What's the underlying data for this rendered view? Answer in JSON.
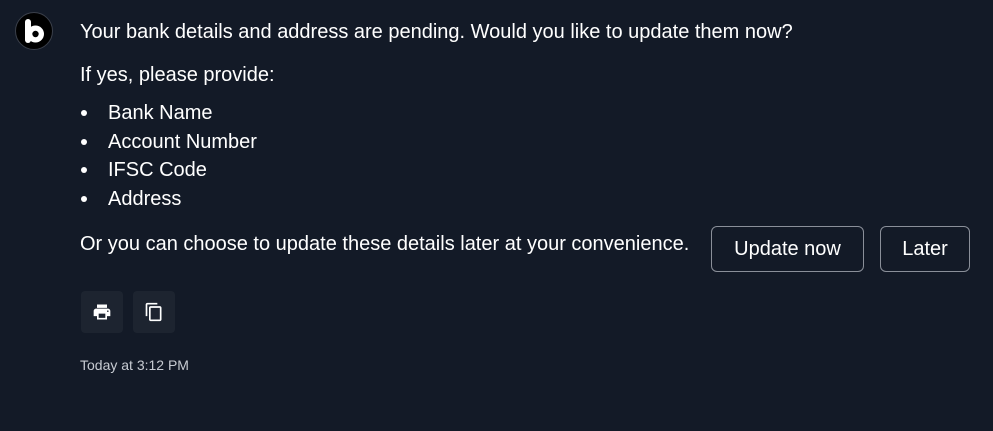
{
  "avatar": {
    "icon": "bot-logo-b-icon"
  },
  "message": {
    "question": "Your bank details and address are pending. Would you like to update them now?",
    "prompt": "If yes, please provide:",
    "fields": [
      {
        "label": "Bank Name"
      },
      {
        "label": "Account Number"
      },
      {
        "label": "IFSC Code"
      },
      {
        "label": "Address"
      }
    ],
    "later_note": "Or you can choose to update these details later at your convenience."
  },
  "actions": {
    "update_label": "Update now",
    "later_label": "Later"
  },
  "toolbar": {
    "print_icon": "print-icon",
    "copy_icon": "copy-icon"
  },
  "timestamp": "Today at 3:12 PM",
  "colors": {
    "background": "#131a27",
    "text": "#ffffff",
    "muted_text": "#c7cbd2",
    "button_border": "#8a8f99",
    "icon_button_bg": "#1d2430"
  }
}
